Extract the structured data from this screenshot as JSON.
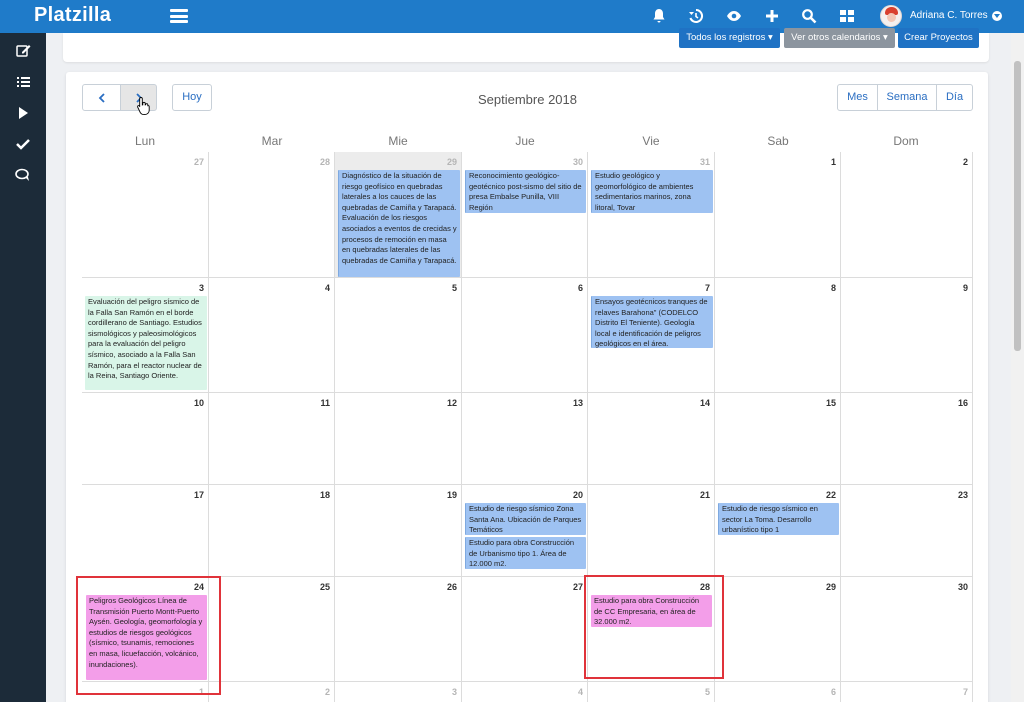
{
  "app": {
    "brand": "Platzilla",
    "user_name": "Adriana C. Torres"
  },
  "topbar_icons": [
    "bell-icon",
    "history-icon",
    "eye-icon",
    "plus-icon",
    "search-icon",
    "grid-icon"
  ],
  "sidebar_icons": [
    "edit-icon",
    "list-icon",
    "play-icon",
    "check-icon",
    "chat-icon"
  ],
  "toolbar": {
    "registros_label": "Todos los registros",
    "otros_label": "Ver otros calendarios",
    "crear_label": "Crear Proyectos"
  },
  "calendar": {
    "title": "Septiembre 2018",
    "today_label": "Hoy",
    "views": [
      "Mes",
      "Semana",
      "Día"
    ],
    "weekdays": [
      "Lun",
      "Mar",
      "Mie",
      "Jue",
      "Vie",
      "Sab",
      "Dom"
    ],
    "weeks": [
      [
        "27",
        "28",
        "29",
        "30",
        "31",
        "1",
        "2"
      ],
      [
        "3",
        "4",
        "5",
        "6",
        "7",
        "8",
        "9"
      ],
      [
        "10",
        "11",
        "12",
        "13",
        "14",
        "15",
        "16"
      ],
      [
        "17",
        "18",
        "19",
        "20",
        "21",
        "22",
        "23"
      ],
      [
        "24",
        "25",
        "26",
        "27",
        "28",
        "29",
        "30"
      ],
      [
        "1",
        "2",
        "3",
        "4",
        "5",
        "6",
        "7"
      ]
    ],
    "events": {
      "w0_mie": "Diagnóstico de la situación de riesgo geofísico en quebradas laterales a los cauces de las quebradas de Camiña y Tarapacá. Evaluación de los riesgos asociados a eventos de crecidas y procesos de remoción en masa en quebradas laterales de las quebradas de Camiña y Tarapacá.",
      "w0_jue": "Reconocimiento geológico-geotécnico post-sismo del sitio de presa Embalse Punilla, VIII Región",
      "w0_vie": "Estudio geológico y geomorfológico de ambientes sedimentarios marinos, zona litoral, Tovar",
      "w1_lun": "Evaluación del peligro sísmico de la Falla San Ramón en el borde cordillerano de Santiago. Estudios sismológicos y paleosimológicos para la evaluación del peligro sísmico, asociado a la Falla San Ramón, para el reactor nuclear de la Reina, Santiago Oriente.",
      "w1_vie": "Ensayos geotécnicos tranques de relaves Barahona\" (CODELCO Distrito El Teniente). Geología local e identificación de peligros geológicos en el área.",
      "w3_jue_1": "Estudio de riesgo sísmico Zona Santa Ana. Ubicación de Parques Temáticos",
      "w3_jue_2": "Estudio para obra Construcción de Urbanismo tipo 1. Área de 12.000 m2.",
      "w3_sab": "Estudio de riesgo sísmico en sector La Toma. Desarrollo urbanístico tipo 1",
      "w4_lun": "Peligros Geológicos Línea de Transmisión Puerto Montt-Puerto Aysén. Geología, geomorfología y estudios de riesgos geológicos (sísmico, tsunamis, remociones en masa, licuefacción, volcánico, inundaciones).",
      "w4_vie": "Estudio para obra Construcción de CC Empresaria, en área de 32.000 m2."
    }
  },
  "colors": {
    "topbar": "#1f7bc9",
    "sidebar": "#1c2b39",
    "event_blue": "#9ec2f2",
    "event_mint": "#d9f5e8",
    "event_pink": "#f39ee9",
    "highlight": "#e0333a"
  }
}
